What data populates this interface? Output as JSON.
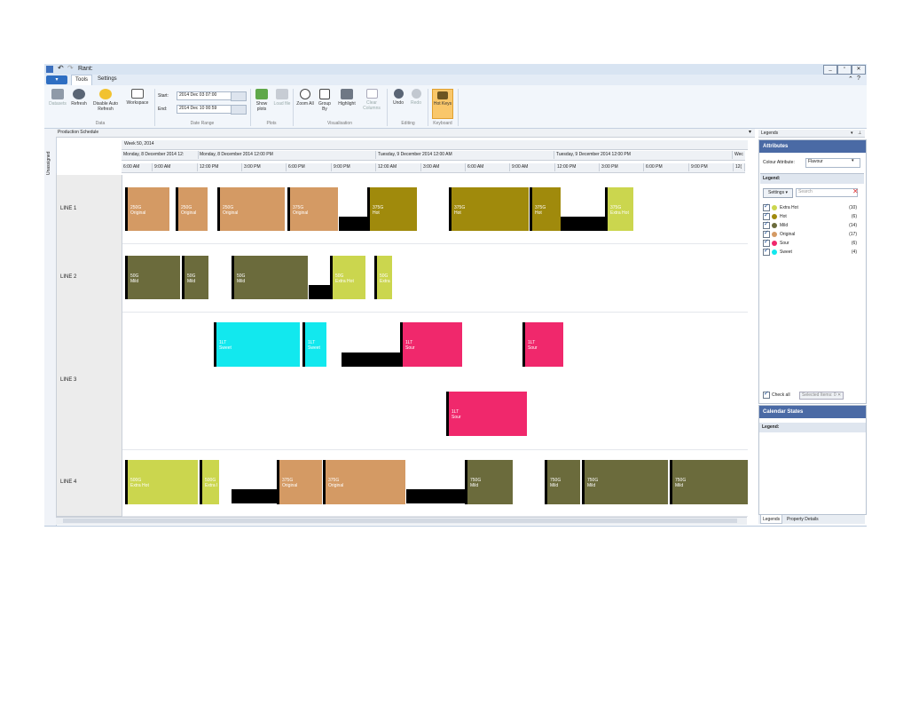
{
  "app": {
    "title": "Rant:",
    "file_button": "▾",
    "window_controls": [
      "_",
      "▫",
      "✕"
    ]
  },
  "tabs": [
    {
      "label": "Tools",
      "active": true
    },
    {
      "label": "Settings",
      "active": false
    }
  ],
  "ribbon": {
    "data": {
      "label": "Data",
      "datasets": "Datasets",
      "refresh": "Refresh",
      "disable_auto_refresh": "Disable Auto Refresh",
      "workspace": "Workspace"
    },
    "date_range": {
      "label": "Date Range",
      "start_label": "Start:",
      "start_value": "2014 Dec 03 07:00",
      "end_label": "End:",
      "end_value": "2014 Dec 10 00:59"
    },
    "plots": {
      "label": "Plots",
      "show_plots": "Show plots",
      "load_file": "Load file"
    },
    "visualisation": {
      "label": "Visualisation",
      "zoom_all": "Zoom All",
      "group_by": "Group By",
      "highlight": "Highlight",
      "clear_columns": "Clear Columns"
    },
    "editing": {
      "label": "Editing",
      "undo": "Undo",
      "redo": "Redo"
    },
    "keyboard": {
      "label": "Keyboard",
      "hot_keys": "Hot Keys"
    }
  },
  "left_strip": {
    "label": "Unassigned"
  },
  "schedule": {
    "title": "Production Schedule",
    "week_label": "Week 50, 2014",
    "day_headers": [
      "Monday, 8 December 2014 12:",
      "Monday, 8 December 2014 12:00 PM",
      "Tuesday, 9 December 2014 12:00 AM",
      "Tuesday, 9 December 2014 12:00 PM",
      "Wec"
    ],
    "time_headers": [
      "6:00 AM",
      "9:00 AM",
      "12:00 PM",
      "3:00 PM",
      "6:00 PM",
      "9:00 PM",
      "12:00 AM",
      "3:00 AM",
      "6:00 AM",
      "9:00 AM",
      "12:00 PM",
      "3:00 PM",
      "6:00 PM",
      "9:00 PM",
      "12("
    ],
    "lines": [
      {
        "name": "LINE 1",
        "bars": [
          {
            "size": "250G",
            "flavour": "Original"
          },
          {
            "size": "250G",
            "flavour": "Original"
          },
          {
            "size": "250G",
            "flavour": "Original"
          },
          {
            "size": "375G",
            "flavour": "Original"
          },
          {
            "size": "375G",
            "flavour": "Hot"
          },
          {
            "size": "375G",
            "flavour": "Hot"
          },
          {
            "size": "375G",
            "flavour": "Hot"
          },
          {
            "size": "375G",
            "flavour": "Extra Hot"
          }
        ]
      },
      {
        "name": "LINE 2",
        "bars": [
          {
            "size": "50G",
            "flavour": "Mild"
          },
          {
            "size": "50G",
            "flavour": "Mild"
          },
          {
            "size": "50G",
            "flavour": "Mild"
          },
          {
            "size": "50G",
            "flavour": "Extra Hot"
          },
          {
            "size": "50G",
            "flavour": "Extra"
          }
        ]
      },
      {
        "name": "LINE 3",
        "bars": [
          {
            "size": "1LT",
            "flavour": "Sweet"
          },
          {
            "size": "1LT",
            "flavour": "Sweet"
          },
          {
            "size": "1LT",
            "flavour": "Sour"
          },
          {
            "size": "1LT",
            "flavour": "Sour"
          },
          {
            "size": "1LT",
            "flavour": "Sour"
          }
        ]
      },
      {
        "name": "LINE 4",
        "bars": [
          {
            "size": "500G",
            "flavour": "Extra Hot"
          },
          {
            "size": "500G",
            "flavour": "Extra I"
          },
          {
            "size": "375G",
            "flavour": "Original"
          },
          {
            "size": "375G",
            "flavour": "Original"
          },
          {
            "size": "750G",
            "flavour": "Mild"
          },
          {
            "size": "750G",
            "flavour": "Mild"
          },
          {
            "size": "750G",
            "flavour": "Mild"
          },
          {
            "size": "750G",
            "flavour": "Mild"
          }
        ]
      }
    ]
  },
  "colors": {
    "Original": "#d49a64",
    "Hot": "#a08a0c",
    "Extra Hot": "#cbd64e",
    "Extra": "#cbd64e",
    "Extra I": "#cbd64e",
    "Mild": "#6b6b3c",
    "Sweet": "#12e8ee",
    "Sour": "#f0286c"
  },
  "right_panel": {
    "dropdown_label": "Legends",
    "attributes_header": "Attributes",
    "colour_attribute_label": "Colour Attribute:",
    "colour_attribute_value": "Flavour",
    "legend_label": "Legend:",
    "settings_button": "Settings",
    "search_placeholder": "Search",
    "legend_items": [
      {
        "name": "Extra Hot",
        "count": "(10)",
        "color": "#cbd64e"
      },
      {
        "name": "Hot",
        "count": "(6)",
        "color": "#a08a0c"
      },
      {
        "name": "Mild",
        "count": "(14)",
        "color": "#6b6b3c"
      },
      {
        "name": "Original",
        "count": "(17)",
        "color": "#d49a64"
      },
      {
        "name": "Sour",
        "count": "(6)",
        "color": "#f0286c"
      },
      {
        "name": "Sweet",
        "count": "(4)",
        "color": "#12e8ee"
      }
    ],
    "check_all": "Check all",
    "selected_items": "Selected Items: 0",
    "calendar_header": "Calendar States",
    "calendar_legend_label": "Legend:",
    "bottom_tabs": [
      "Legends",
      "Property Details"
    ]
  }
}
